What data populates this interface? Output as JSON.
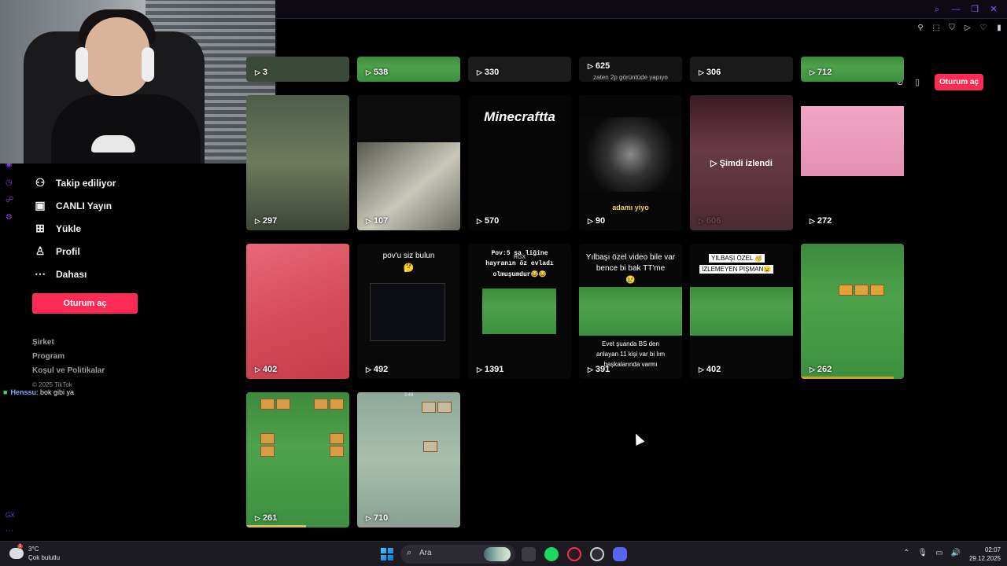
{
  "sidebar": {
    "items": [
      {
        "label": "Takip ediliyor",
        "icon": "following-icon"
      },
      {
        "label": "CANLI Yayın",
        "icon": "live-icon"
      },
      {
        "label": "Yükle",
        "icon": "upload-icon"
      },
      {
        "label": "Profil",
        "icon": "profile-icon"
      },
      {
        "label": "Dahası",
        "icon": "more-icon"
      }
    ],
    "login_label": "Oturum aç",
    "footer": [
      "Şirket",
      "Program",
      "Koşul ve Politikalar"
    ],
    "copyright": "© 2025 TikTok"
  },
  "chat": {
    "user": "Henssu",
    "message": ": bok gibi ya"
  },
  "header": {
    "login_label": "Oturum aç"
  },
  "grid": {
    "row0": [
      "3",
      "538",
      "330",
      "625",
      "306",
      "712"
    ],
    "row0_caption": "zaten 2p görüntüde yapıyo",
    "row1": [
      "297",
      "107",
      "570",
      "90",
      "606",
      "272"
    ],
    "row1_overlays": {
      "minecraft": "Minecraftta",
      "adami": "adamı yiyo",
      "watched": "Şimdi izlendi"
    },
    "row2": [
      "402",
      "492",
      "1391",
      "391",
      "402",
      "262"
    ],
    "row2_overlays": {
      "pov": "pov'u siz bulun",
      "pov_emoji": "🤔",
      "pov5_line1": "Pov:5 sa   liğine",
      "pov5_line2": "hayranın öz evladı",
      "pov5_line3": "olmuşumdur😂😂",
      "pov5_tag": "RGX",
      "yilbasi": "Yılbaşı özel video bile var bence bi bak TT'me",
      "yilbasi_emoji": "😢",
      "evet": "Evet şuanda BS den anlayan 11 kişi var bi   lım başkalarında varmı",
      "ozel_line1": "YILBAŞI ÖZEL 🥳",
      "ozel_line2": "İZLEMEYEN PİŞMAN😦"
    },
    "row3": [
      "261",
      "710"
    ],
    "row3_timer": "3:49"
  },
  "taskbar": {
    "weather_temp": "3°C",
    "weather_desc": "Çok bulutlu",
    "weather_badge": "1",
    "search_label": "Ara",
    "time": "02:07",
    "date": "29.12.2025"
  },
  "gx": {
    "label": "GX"
  },
  "colors": {
    "accent": "#fe2c55",
    "gx_purple": "#8a5cf5",
    "background": "#000000"
  }
}
